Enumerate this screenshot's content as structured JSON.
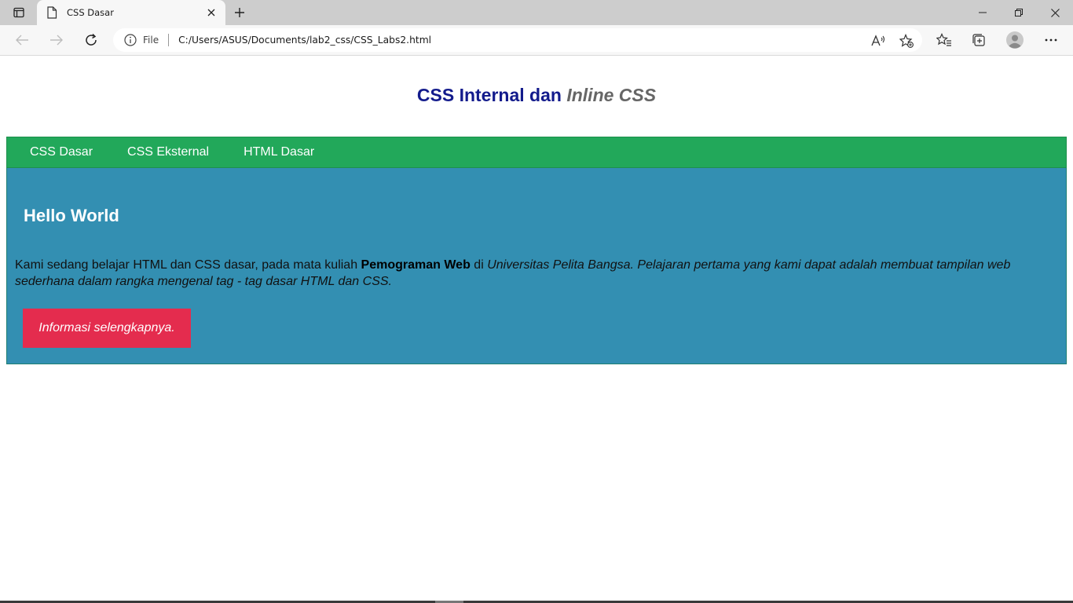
{
  "browser": {
    "tab_title": "CSS Dasar",
    "omnibox_file_label": "File",
    "url": "C:/Users/ASUS/Documents/lab2_css/CSS_Labs2.html"
  },
  "page": {
    "heading_part1": "CSS Internal dan",
    "heading_part2": "Inline CSS",
    "nav_items": [
      "CSS Dasar",
      "CSS Eksternal",
      "HTML Dasar"
    ],
    "hero": {
      "title": "Hello World",
      "text_1": "Kami sedang belajar HTML dan CSS dasar, pada mata kuliah",
      "text_bold": "Pemograman Web",
      "text_2": "di",
      "text_italic": "Universitas Pelita Bangsa. Pelajaran pertama yang kami dapat adalah membuat tampilan web sederhana dalam rangka mengenal tag - tag dasar HTML dan CSS.",
      "button_label": "Informasi selengkapnya."
    }
  },
  "colors": {
    "heading": "#131b8c",
    "heading_italic": "#666666",
    "navbar": "#22a85a",
    "hero_bg": "#338fb2",
    "button": "#e42c4e"
  },
  "icons": [
    "tab-actions-icon",
    "page-icon",
    "close-icon",
    "plus-icon",
    "minimize-icon",
    "restore-icon",
    "close-window-icon",
    "back-icon",
    "forward-icon",
    "refresh-icon",
    "info-icon",
    "read-aloud-icon",
    "add-favorite-icon",
    "favorites-icon",
    "collections-icon",
    "profile-icon",
    "more-icon"
  ]
}
